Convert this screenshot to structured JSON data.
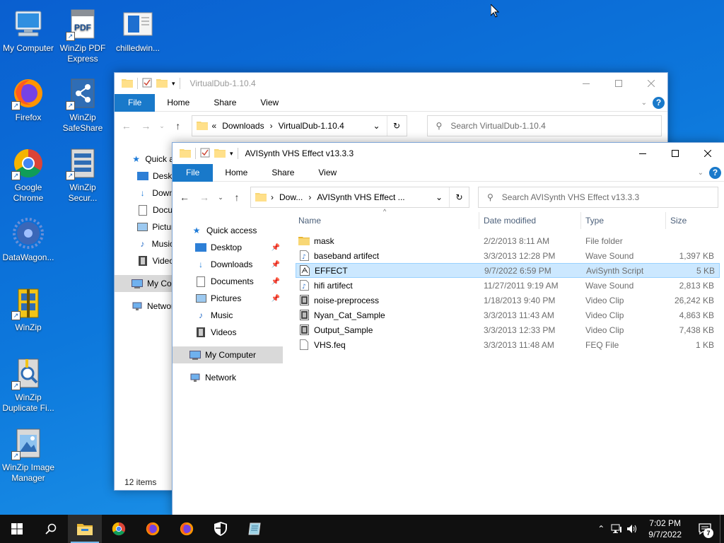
{
  "desktop": {
    "icons": [
      {
        "label": "My Computer"
      },
      {
        "label": "WinZip PDF Express"
      },
      {
        "label": "chilledwin..."
      },
      {
        "label": "Firefox"
      },
      {
        "label": "WinZip SafeShare"
      },
      {
        "label": "Google Chrome"
      },
      {
        "label": "WinZip Secur..."
      },
      {
        "label": "DataWagon..."
      },
      {
        "label": "WinZip"
      },
      {
        "label": "WinZip Duplicate Fi..."
      },
      {
        "label": "WinZip Image Manager"
      }
    ]
  },
  "back_window": {
    "title": "VirtualDub-1.10.4",
    "tabs": {
      "file": "File",
      "home": "Home",
      "share": "Share",
      "view": "View"
    },
    "address": {
      "chevron": "«",
      "part1": "Downloads",
      "part2": "VirtualDub-1.10.4"
    },
    "search_placeholder": "Search VirtualDub-1.10.4",
    "nav": [
      "Quick a",
      "Deskt",
      "Down",
      "Docu",
      "Pictur",
      "Music",
      "Video",
      "My Cor",
      "Networ"
    ],
    "status": "12 items"
  },
  "front_window": {
    "title": "AVISynth VHS Effect v13.3.3",
    "tabs": {
      "file": "File",
      "home": "Home",
      "share": "Share",
      "view": "View"
    },
    "address": {
      "part1": "Dow...",
      "part2": "AVISynth VHS Effect ..."
    },
    "search_placeholder": "Search AVISynth VHS Effect v13.3.3",
    "nav": {
      "quick_access": "Quick access",
      "desktop": "Desktop",
      "downloads": "Downloads",
      "documents": "Documents",
      "pictures": "Pictures",
      "music": "Music",
      "videos": "Videos",
      "my_computer": "My Computer",
      "network": "Network"
    },
    "columns": {
      "name": "Name",
      "date": "Date modified",
      "type": "Type",
      "size": "Size"
    },
    "files": [
      {
        "name": "mask",
        "date": "2/2/2013 8:11 AM",
        "type": "File folder",
        "size": "",
        "icon": "folder-icon"
      },
      {
        "name": "baseband artifect",
        "date": "3/3/2013 12:28 PM",
        "type": "Wave Sound",
        "size": "1,397 KB",
        "icon": "audio-file-icon"
      },
      {
        "name": "EFFECT",
        "date": "9/7/2022 6:59 PM",
        "type": "AviSynth Script",
        "size": "5 KB",
        "icon": "script-file-icon"
      },
      {
        "name": "hifi artifect",
        "date": "11/27/2011 9:19 AM",
        "type": "Wave Sound",
        "size": "2,813 KB",
        "icon": "audio-file-icon"
      },
      {
        "name": "noise-preprocess",
        "date": "1/18/2013 9:40 PM",
        "type": "Video Clip",
        "size": "26,242 KB",
        "icon": "video-file-icon"
      },
      {
        "name": "Nyan_Cat_Sample",
        "date": "3/3/2013 11:43 AM",
        "type": "Video Clip",
        "size": "4,863 KB",
        "icon": "video-file-icon"
      },
      {
        "name": "Output_Sample",
        "date": "3/3/2013 12:33 PM",
        "type": "Video Clip",
        "size": "7,438 KB",
        "icon": "video-file-icon"
      },
      {
        "name": "VHS.feq",
        "date": "3/3/2013 11:48 AM",
        "type": "FEQ File",
        "size": "1 KB",
        "icon": "file-icon"
      }
    ]
  },
  "taskbar": {
    "time": "7:02 PM",
    "date": "9/7/2022",
    "notifications": "7",
    "accent": "#76b9ed"
  }
}
